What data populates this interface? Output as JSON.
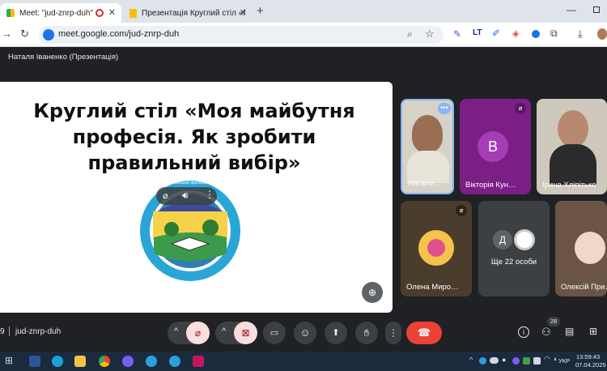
{
  "browser": {
    "tabs": [
      {
        "label": "Meet: \"jud-znrp-duh\"",
        "active": true
      },
      {
        "label": "Презентація Круглий стіл «Мо",
        "active": false
      }
    ],
    "new_tab_glyph": "+",
    "url": "meet.google.com/jud-znrp-duh"
  },
  "meet": {
    "presenter_label": "Наталя Іваненко (Презентація)",
    "slide": {
      "title_lines": [
        "Круглий стіл «Моя майбутня",
        "професія. Як зробити",
        "правильний вибір»"
      ],
      "logo_ring_text": "ВСП «Донбаський фаховий коледж СНУ ім. В. Даля»"
    },
    "participants": [
      {
        "name": "Наталя…",
        "type": "video"
      },
      {
        "name": "Вікторія Кун…",
        "type": "avatar",
        "initial": "В",
        "avatar_color": "#8e24aa",
        "muted": true
      },
      {
        "name": "Ірина Хліпітько",
        "type": "video"
      },
      {
        "name": "Олена Миро…",
        "type": "image",
        "muted": true
      },
      {
        "name": "Ще 22 особи",
        "type": "more",
        "initial": "Д"
      },
      {
        "name": "Олексій При…",
        "type": "video"
      }
    ],
    "meeting_code_prefix": "9",
    "meeting_code": "jud-znrp-duh",
    "people_count": "28"
  },
  "taskbar": {
    "time": "13:59:43",
    "date": "07.04.2025",
    "language": "УКР"
  },
  "colors": {
    "meet_bg": "#202124",
    "end_call_red": "#ea4335",
    "mute_red_bg": "#f9dede",
    "tab_strip": "#dfe3ea"
  }
}
